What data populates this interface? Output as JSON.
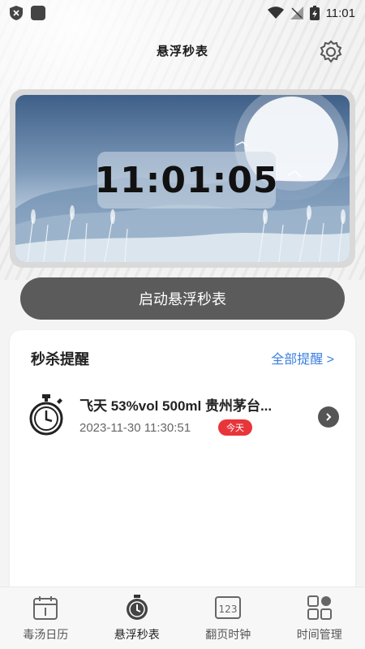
{
  "status_bar": {
    "time": "11:01"
  },
  "header": {
    "title": "悬浮秒表"
  },
  "hero": {
    "clock": "11:01:05"
  },
  "start_button": {
    "label": "启动悬浮秒表"
  },
  "reminders": {
    "title": "秒杀提醒",
    "all_link": "全部提醒 >",
    "items": [
      {
        "name": "飞天 53%vol 500ml 贵州茅台...",
        "time": "2023-11-30 11:30:51",
        "badge": "今天"
      }
    ]
  },
  "tabs": [
    {
      "label": "毒汤日历",
      "icon": "calendar-icon"
    },
    {
      "label": "悬浮秒表",
      "icon": "stopwatch-icon",
      "active": true
    },
    {
      "label": "翻页时钟",
      "icon": "flip-clock-icon"
    },
    {
      "label": "时间管理",
      "icon": "grid-icon"
    }
  ]
}
